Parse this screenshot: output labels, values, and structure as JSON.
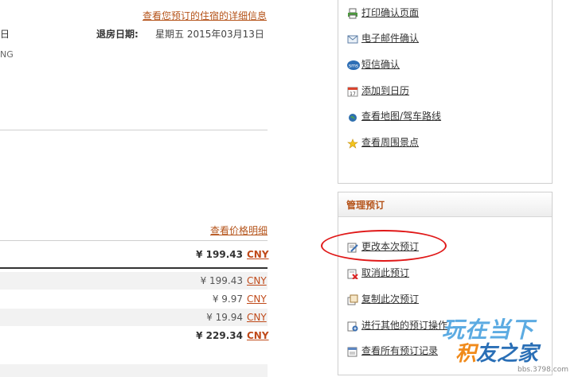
{
  "header": {
    "details_link": "查看您预订的住宿的详细信息",
    "checkin_fragment": "日",
    "checkout_label": "退房日期:",
    "checkout_value": "星期五 2015年03月13日",
    "name_fragment": "NG"
  },
  "pricing": {
    "price_detail_link": "查看价格明细",
    "rows": [
      {
        "amount": "¥ 199.43",
        "currency": "CNY",
        "bold": true
      },
      {
        "amount": "¥ 199.43",
        "currency": "CNY",
        "bold": false
      },
      {
        "amount": "¥ 9.97",
        "currency": "CNY",
        "bold": false
      },
      {
        "amount": "¥ 19.94",
        "currency": "CNY",
        "bold": false
      },
      {
        "amount": "¥ 229.34",
        "currency": "CNY",
        "bold": true
      }
    ]
  },
  "actions_panel": {
    "items": [
      {
        "label": "打印确认页面",
        "icon": "printer-icon"
      },
      {
        "label": "电子邮件确认",
        "icon": "envelope-icon"
      },
      {
        "label": "短信确认",
        "icon": "sms-icon"
      },
      {
        "label": "添加到日历",
        "icon": "calendar-icon"
      },
      {
        "label": "查看地图/驾车路线",
        "icon": "globe-icon"
      },
      {
        "label": "查看周围景点",
        "icon": "star-icon"
      }
    ]
  },
  "manage_panel": {
    "title": "管理预订",
    "items": [
      {
        "label": "更改本次预订",
        "icon": "edit-booking-icon"
      },
      {
        "label": "取消此预订",
        "icon": "cancel-booking-icon"
      },
      {
        "label": "复制此次预订",
        "icon": "copy-booking-icon"
      },
      {
        "label": "进行其他的预订操作",
        "icon": "other-booking-icon"
      },
      {
        "label": "查看所有预订记录",
        "icon": "booking-history-icon"
      }
    ]
  },
  "watermark": {
    "line1": "玩在当下",
    "line2_a": "积",
    "line2_b": "友之家",
    "url": "bbs.3798.com"
  },
  "colors": {
    "accent": "#b5541b",
    "currency": "#c04a1a",
    "highlight": "#e01818"
  }
}
